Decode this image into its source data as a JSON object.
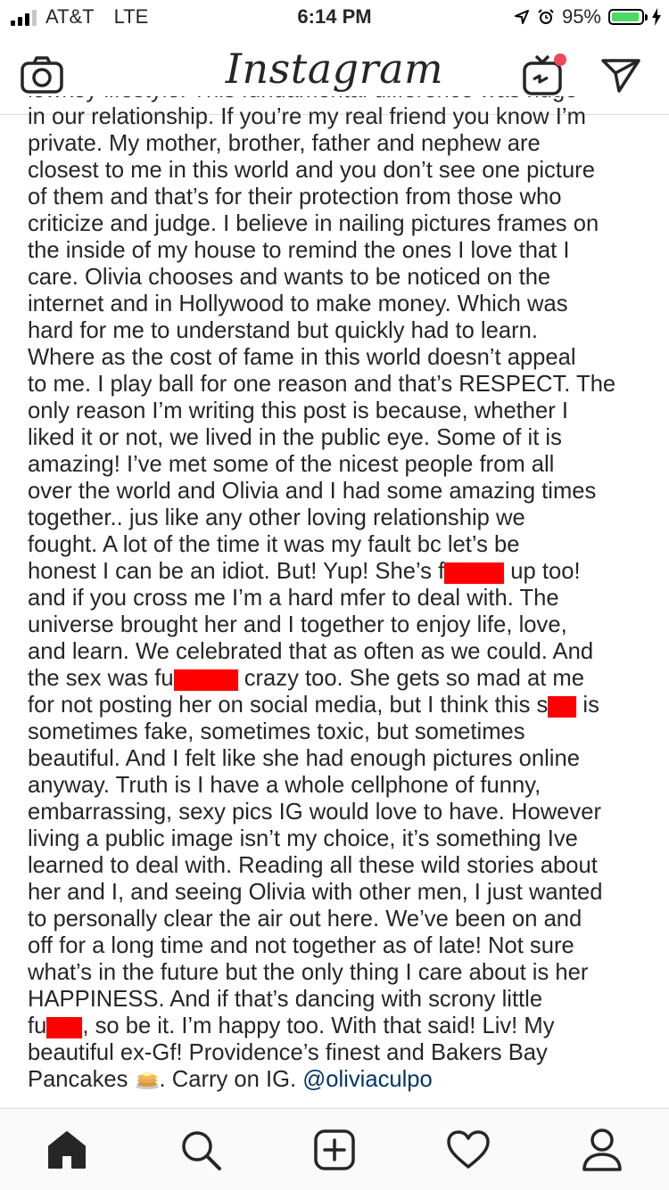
{
  "status_bar": {
    "carrier": "AT&T",
    "network": "LTE",
    "time": "6:14 PM",
    "battery_percent": "95%",
    "battery_level": 0.95
  },
  "nav": {
    "title": "Instagram"
  },
  "icons": {
    "camera": "camera-icon",
    "igtv": "igtv-icon",
    "direct": "direct-message-icon",
    "home": "home-icon",
    "search": "search-icon",
    "new_post": "new-post-icon",
    "activity": "activity-heart-icon",
    "profile": "profile-icon"
  },
  "colors": {
    "redaction": "#ff0000",
    "mention": "#003569",
    "notification_dot": "#ed4956",
    "battery": "#4cd964"
  },
  "post": {
    "top_partial_line": "lowkey lifestyle. This fundamental difference was huge",
    "lines": [
      "in our relationship. If you’re my real friend you know I’m",
      "private. My mother, brother, father and nephew are",
      "closest to me in this world and you don’t see one picture",
      "of them and that’s for their protection from those who",
      "criticize and judge. I believe in nailing pictures frames on",
      "the inside of my house to remind the ones I love that I",
      "care. Olivia chooses and wants to be noticed on the",
      "internet and in Hollywood to make money. Which was",
      "hard for me to understand but quickly had to learn.",
      "Where as the cost of fame in this world doesn’t appeal",
      "to me. I play ball for one reason and that’s RESPECT. The",
      "only reason I’m writing this post is because, whether I",
      "liked it or not, we lived in the public eye. Some of it is",
      "amazing! I’ve met some of the nicest people from all",
      "over the world and Olivia and I had some amazing times",
      "together.. jus like any other loving relationship we",
      "fought. A lot of the time it was my fault bc let’s be"
    ],
    "l17_a": "honest I can be an idiot. But! Yup! She’s f",
    "l17_b": " up too!",
    "lines2": [
      "and if you cross me I’m a hard mfer to deal with. The",
      "universe brought her and I together to enjoy life, love,",
      "and learn. We celebrated that as often as we could. And"
    ],
    "l21_a": "the sex was fu",
    "l21_b": " crazy too. She gets so mad at me",
    "l22_a": "for not posting her on social media, but I think this s",
    "l22_b": " is",
    "lines3": [
      "sometimes fake, sometimes toxic, but sometimes",
      "beautiful. And I felt like she had enough pictures online",
      "anyway. Truth is I have a whole cellphone of funny,",
      "embarrassing, sexy pics IG would love to have. However",
      "living a public image isn’t my choice, it’s something Ive",
      "learned to deal with. Reading all these wild stories about",
      "her and I, and seeing Olivia with other men, I just wanted",
      "to personally clear the air out here. We’ve been on and",
      "off for a long time and not together as of late! Not sure",
      "what’s in the future but the only thing I care about is her",
      "HAPPINESS. And if that’s dancing with scrony little"
    ],
    "l34_a": "fu",
    "l34_b": ", so be it. I’m happy too. With that said! Liv! My",
    "l35": "beautiful ex-Gf! Providence’s finest and Bakers Bay",
    "l36_a": "Pancakes",
    "l36_b": ". Carry on IG.",
    "mention": "@oliviaculpo"
  }
}
